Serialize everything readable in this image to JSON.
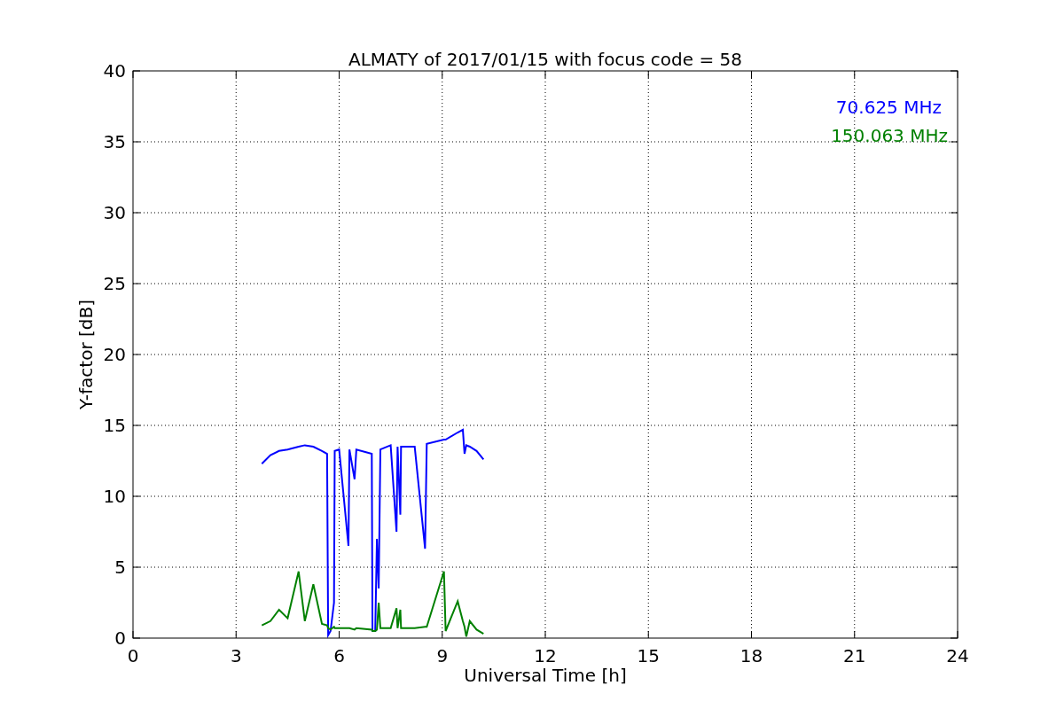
{
  "chart_data": {
    "type": "line",
    "title": "ALMATY of 2017/01/15 with focus code = 58",
    "xlabel": "Universal Time [h]",
    "ylabel": "Y-factor [dB]",
    "x": [
      3.75,
      4.0,
      4.25,
      4.5,
      4.82,
      5.0,
      5.25,
      5.5,
      5.65,
      5.68,
      5.75,
      5.85,
      5.87,
      6.0,
      6.27,
      6.3,
      6.45,
      6.5,
      6.95,
      6.97,
      7.05,
      7.1,
      7.15,
      7.2,
      7.5,
      7.67,
      7.7,
      7.78,
      7.8,
      8.2,
      8.5,
      8.55,
      9.05,
      9.1,
      9.45,
      9.6,
      9.65,
      9.7,
      9.8,
      10.0,
      10.2
    ],
    "series": [
      {
        "name": "70.625 MHz",
        "color": "#0000ff",
        "values": [
          12.3,
          12.9,
          13.2,
          13.3,
          13.5,
          13.6,
          13.5,
          13.2,
          13.0,
          0.2,
          0.5,
          2.5,
          13.2,
          13.3,
          6.5,
          13.3,
          11.2,
          13.3,
          13.0,
          0.5,
          0.5,
          7.0,
          3.5,
          13.3,
          13.6,
          7.5,
          13.5,
          8.7,
          13.5,
          13.5,
          6.3,
          13.7,
          14.0,
          14.0,
          14.5,
          14.7,
          13.0,
          13.6,
          13.5,
          13.2,
          12.6
        ]
      },
      {
        "name": "150.063 MHz",
        "color": "#008000",
        "values": [
          0.9,
          1.2,
          2.0,
          1.4,
          4.7,
          1.2,
          3.8,
          1.0,
          0.9,
          0.7,
          0.6,
          0.8,
          0.7,
          0.7,
          0.7,
          0.7,
          0.6,
          0.7,
          0.6,
          0.5,
          0.5,
          0.6,
          2.5,
          0.7,
          0.7,
          2.1,
          0.7,
          2.0,
          0.7,
          0.7,
          0.8,
          0.8,
          4.7,
          0.5,
          2.6,
          1.2,
          0.8,
          0.1,
          1.2,
          0.6,
          0.3
        ]
      }
    ],
    "grid": true,
    "xlim": [
      0,
      24
    ],
    "ylim": [
      0,
      40
    ],
    "xticks": [
      0,
      3,
      6,
      9,
      12,
      15,
      18,
      21,
      24
    ],
    "yticks": [
      0,
      5,
      10,
      15,
      20,
      25,
      30,
      35,
      40
    ]
  }
}
